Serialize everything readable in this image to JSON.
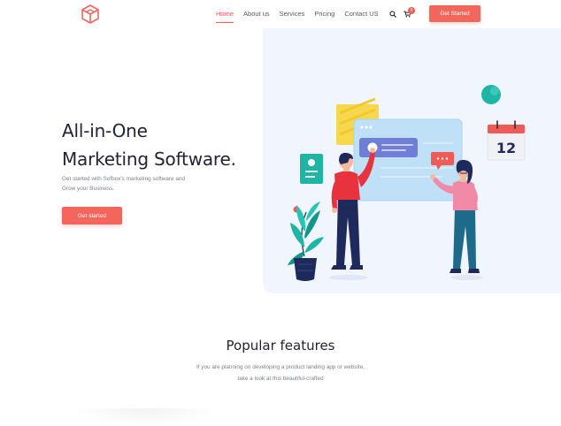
{
  "nav": {
    "items": [
      {
        "label": "Home",
        "active": true
      },
      {
        "label": "About us",
        "active": false
      },
      {
        "label": "Services",
        "active": false
      },
      {
        "label": "Pricing",
        "active": false
      },
      {
        "label": "Contact US",
        "active": false
      }
    ],
    "cart_count": "0",
    "cta_label": "Get Started",
    "icons": {
      "logo": "cube-logo-icon",
      "search": "search-icon",
      "cart": "cart-icon"
    }
  },
  "hero": {
    "title_line1": "All-in-One",
    "title_line2": "Marketing Software.",
    "subtitle_line1": "Get started with Sofbox's marketing software and",
    "subtitle_line2": "Grow your Business.",
    "cta_label": "Get started",
    "calendar_day": "12"
  },
  "features": {
    "title": "Popular features",
    "subtitle_line1": "If you are planning on developing a product landing app or website,",
    "subtitle_line2": "take a look at this beautiful-crafted"
  },
  "colors": {
    "accent": "#f2665c",
    "hero_bg": "#f1f5fd",
    "teal": "#1fb5a5",
    "navy": "#1f2a5c",
    "pink": "#f08aa7"
  }
}
